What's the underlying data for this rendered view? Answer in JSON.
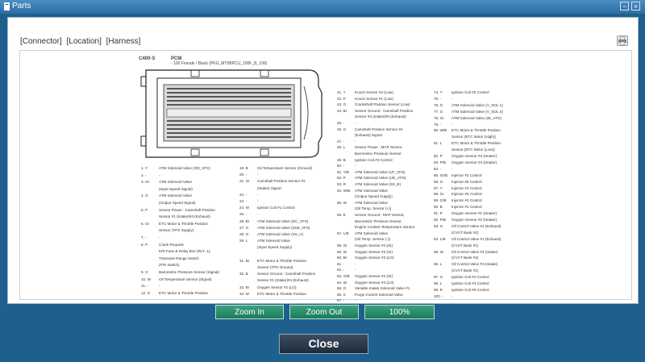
{
  "window": {
    "title": "Parts",
    "minimize_label": "−",
    "close_label": "×"
  },
  "tabs": [
    "[Connector]",
    "[Location]",
    "[Harness]"
  ],
  "connector": {
    "code": "C400-S",
    "name": "PCM",
    "subtitle": "- 100 Female / Black (PKG_MT0BPCU_100F_B_100)"
  },
  "pins_col1": [
    "1. Y",
    "2. -",
    "3. Gr",
    "",
    "4. G",
    "",
    "5. P",
    "",
    "6. Gr",
    "",
    "7. -",
    "8. P",
    "",
    "",
    "",
    "9. O",
    "10. W",
    "11. -",
    "12. G"
  ],
  "pins_col1_desc": [
    "ATM Solenoid Valve (OD_VFS)",
    "-",
    "ATM Solenoid Valve",
    "(Input Speed Signal)",
    "ATM Solenoid Valve",
    "(Output Speed Signal)",
    "Sensor Power : Camshaft Position",
    "Sensor #1 (Intake)#4 (Exhaust)",
    "ETC Motor & Throttle Position",
    "Sensor (TPS Supply)",
    "-",
    "Crank Request",
    "E/R Fuse & Relay Box (RLY. 1),",
    "Transaxle Range Switch",
    "(P/N Switch)",
    "Barometric Pressure Sensor (Signal)",
    "Oil Temperature Sensor (Signal)",
    "-",
    "ETC Motor & Throttle Position"
  ],
  "pins_col2": [
    "19. B",
    "20. -",
    "21. Gr",
    "",
    "22. -",
    "23. -",
    "24. W",
    "25. -",
    "26. Br",
    "27. G",
    "28. O",
    "29. L",
    "",
    "",
    "31. Br",
    "",
    "32. B",
    "",
    "33. Br",
    "34. W"
  ],
  "pins_col2_desc": [
    "Oil Temperature Sensor (Ground)",
    "-",
    "Camshaft Position Sensor #2",
    "(Intake) Signal",
    "-",
    "-",
    "Ignition Coil #1 Control",
    "-",
    "ATM Solenoid Valve (DC_VFS)",
    "ATM Solenoid Valve (SS8_VFS)",
    "ATM Solenoid Valve (SS_A)",
    "ATM Solenoid Valve",
    "(Input Speed Supply)",
    "",
    "ETC Motor & Throttle Position",
    "Sensor (TPS Ground)",
    "Sensor Ground : Camshaft Position",
    "Sensor #1 (Intake)#4 (Exhaust)",
    "Oxygen Sensor #2 (LO)",
    "ETC Motor & Throttle Position"
  ],
  "pins_col3": [
    "41. Y",
    "42. P",
    "43. G",
    "44. Br",
    "",
    "45. -",
    "46. G",
    "",
    "47. -",
    "48. L",
    "",
    "49. B",
    "50. -",
    "51. Y/B",
    "52. P",
    "53. R",
    "54. W/B",
    "",
    "55. W",
    "",
    "56. E",
    "",
    "",
    "57. L/B",
    "",
    "58. Gr",
    "59. W",
    "60. Br",
    "61. -",
    "62. -",
    "63. O/B",
    "64. W",
    "65. O",
    "66. S",
    "67. -"
  ],
  "pins_col3_desc": [
    "Knock Sensor #2 (Low)",
    "Knock Sensor #1 (Low)",
    "Crankshaft Position Sensor (Low)",
    "Sensor Ground : Camshaft Position",
    "Sensor #3 (Intake)#5 (Exhaust)",
    "-",
    "Camshaft Position Sensor #4",
    "(Exhaust) Signal",
    "-",
    "Sensor Power : MAP Sensor,",
    "Barometric Pressure Sensor",
    "Ignition Coil #3 Control",
    "-",
    "ATM Solenoid Valve (LP_VFS)",
    "ATM Solenoid Valve (UD_VFS)",
    "ATM Solenoid Valve (SS_B)",
    "ATM Solenoid Valve",
    "(Output Speed Supply)",
    "ATM Solenoid Valve",
    "(Oil Temp. Sensor (+))",
    "Sensor Ground : MAP Sensor,",
    "Barometric Pressure Sensor,",
    "Engine Coolant Temperature Sensor",
    "ATM Solenoid Valve",
    "(Oil Temp. Sensor (-))",
    "Oxygen Sensor #4 (HI)",
    "Oxygen Sensor #3 (HI)",
    "Oxygen Sensor #3 (LO)",
    "-",
    "-",
    "Oxygen Sensor #2 (HI)",
    "Oxygen Sensor #4 (LO)",
    "Variable Intake Solenoid Valve #1",
    "Purge Control Solenoid Valve",
    "-"
  ],
  "pins_col4": [
    "74. Y",
    "75. -",
    "76. G",
    "77. G",
    "78. Gr",
    "79. -",
    "80. W/B",
    "",
    "81. L",
    "",
    "82. P",
    "83. P/B",
    "84. -",
    "85. Gr/B",
    "86. G",
    "87. Y",
    "88. Gr",
    "89. G/B",
    "90. B",
    "91. P",
    "92. P/B",
    "93. G",
    "",
    "94. L/B",
    "",
    "95. W",
    "",
    "96. L",
    "",
    "97. G",
    "98. L",
    "99. R",
    "100. -"
  ],
  "pins_col4_desc": [
    "Ignition Coil #5 Control",
    "-",
    "ATM Solenoid Valve (V_SOL 1)",
    "ATM Solenoid Valve (V_SOL 3)",
    "ATM Solenoid Valve (35_VFS)",
    "-",
    "ETC Motor & Throttle Position",
    "Sensor (ETC Motor (High))",
    "ETC Motor & Throttle Position",
    "Sensor (ETC Motor (Low))",
    "Oxygen Sensor #3 (Heater)",
    "Oxygen Sensor #4 (Heater)",
    "-",
    "Injector #2 Control",
    "Injector #5 Control",
    "Injector #3 Control",
    "Injector #6 Control",
    "Injector #4 Control",
    "Injector #1 Control",
    "Oxygen Sensor #1 (Heater)",
    "Oxygen Sensor #2 (Heater)",
    "Oil Control Valve #2 (Exhaust)",
    "(CVVT Bank #2)",
    "Oil Control Valve #1 (Exhaust)",
    "(CVVT Bank #1)",
    "Oil Control Valve #4 (Intake)",
    "(CVVT Bank #2)",
    "Oil Control Valve #3 (Intake)",
    "(CVVT Bank #1)",
    "Ignition Coil #2 Control",
    "Ignition Coil #4 Control",
    "Ignition Coil #6 Control",
    "-"
  ],
  "zoom": {
    "zoom_in": "Zoom In",
    "zoom_out": "Zoom Out",
    "reset": "100%"
  },
  "footer": {
    "close": "Close"
  },
  "colors": {
    "frame": "#1f5f8e",
    "zoom_button": "#2a8d67",
    "close_button": "#2c3b4d"
  }
}
